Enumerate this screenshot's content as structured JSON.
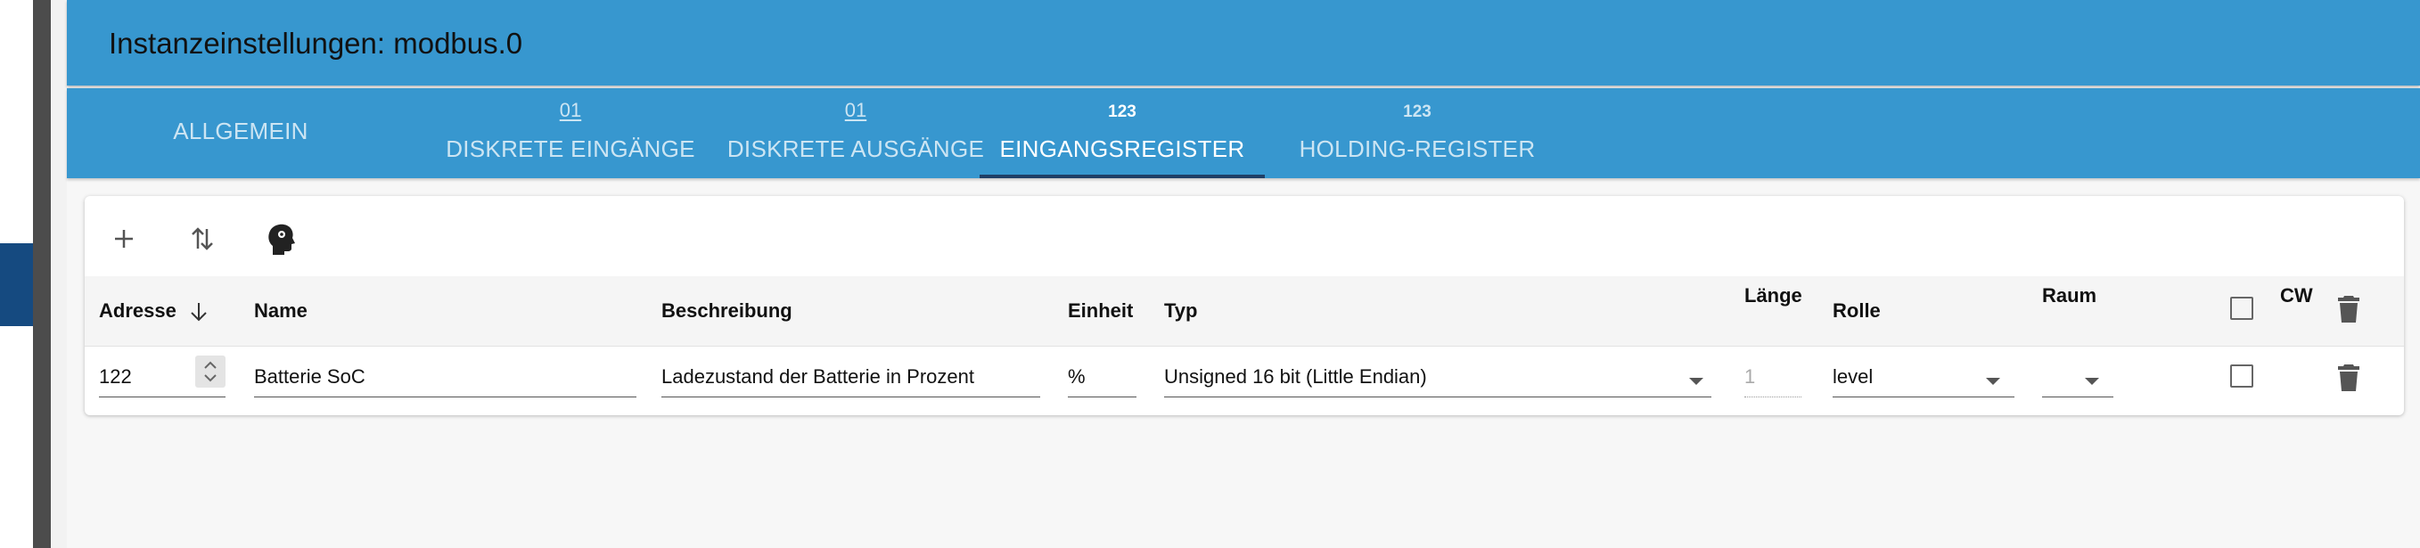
{
  "window": {
    "title": "Instanzeinstellungen: modbus.0"
  },
  "tabs": [
    {
      "label": "ALLGEMEIN",
      "icon": ""
    },
    {
      "label": "DISKRETE EINGÄNGE",
      "icon": "01"
    },
    {
      "label": "DISKRETE AUSGÄNGE",
      "icon": "01"
    },
    {
      "label": "EINGANGSREGISTER",
      "icon": "123"
    },
    {
      "label": "HOLDING-REGISTER",
      "icon": "123"
    }
  ],
  "active_tab": "EINGANGSREGISTER",
  "toolbar": {
    "add_icon": "plus-icon",
    "sort_icon": "swap-vertical-icon",
    "import_icon": "head-icon"
  },
  "table": {
    "columns": {
      "address": "Adresse",
      "name": "Name",
      "description": "Beschreibung",
      "unit": "Einheit",
      "type": "Typ",
      "length": "Länge",
      "role": "Rolle",
      "room": "Raum",
      "cw": "CW"
    },
    "rows": [
      {
        "address": "122",
        "name": "Batterie SoC",
        "description": "Ladezustand der Batterie in Prozent",
        "unit": "%",
        "type": "Unsigned 16 bit (Little Endian)",
        "length": "1",
        "role": "level",
        "room": "",
        "cw": false
      }
    ]
  },
  "colors": {
    "header_blue": "#3797cf",
    "active_indicator": "#1f3f66",
    "sidebar_accent": "#154a80"
  }
}
